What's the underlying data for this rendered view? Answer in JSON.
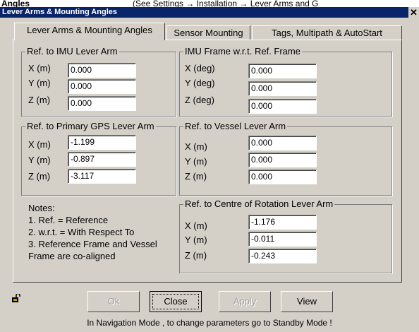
{
  "background": {
    "left_text": "Angles",
    "right_text": "(See Settings → Installation → Lever Arms and G"
  },
  "window": {
    "title": "Lever Arms & Mounting Angles",
    "close_glyph": "✕"
  },
  "tabs": [
    {
      "label": "Lever Arms & Mounting Angles",
      "active": true
    },
    {
      "label": "Sensor Mounting",
      "active": false
    },
    {
      "label": "Tags, Multipath & AutoStart",
      "active": false
    }
  ],
  "groups": {
    "imu_lever": {
      "title": "Ref. to IMU Lever Arm",
      "rows": [
        {
          "label": "X (m)",
          "value": "0.000"
        },
        {
          "label": "Y (m)",
          "value": "0.000"
        },
        {
          "label": "Z (m)",
          "value": "0.000"
        }
      ]
    },
    "imu_frame": {
      "title": "IMU Frame w.r.t. Ref. Frame",
      "rows": [
        {
          "label": "X (deg)",
          "value": "0.000"
        },
        {
          "label": "Y (deg)",
          "value": "0.000"
        },
        {
          "label": "Z (deg)",
          "value": "0.000"
        }
      ]
    },
    "gps_lever": {
      "title": "Ref. to Primary GPS Lever Arm",
      "rows": [
        {
          "label": "X (m)",
          "value": "-1.199"
        },
        {
          "label": "Y (m)",
          "value": "-0.897"
        },
        {
          "label": "Z (m)",
          "value": "-3.117"
        }
      ]
    },
    "vessel_lever": {
      "title": "Ref. to Vessel Lever Arm",
      "rows": [
        {
          "label": "X (m)",
          "value": "0.000"
        },
        {
          "label": "Y (m)",
          "value": "0.000"
        },
        {
          "label": "Z (m)",
          "value": "0.000"
        }
      ]
    },
    "rotation_lever": {
      "title": "Ref. to Centre of Rotation Lever Arm",
      "rows": [
        {
          "label": "X (m)",
          "value": "-1.176"
        },
        {
          "label": "Y (m)",
          "value": "-0.011"
        },
        {
          "label": "Z (m)",
          "value": "-0.243"
        }
      ]
    }
  },
  "notes": [
    "Notes:",
    "1. Ref. = Reference",
    "2. w.r.t. = With Respect To",
    "3. Reference Frame and Vessel",
    " Frame are co-aligned"
  ],
  "buttons": {
    "ok": "Ok",
    "close": "Close",
    "apply": "Apply",
    "view": "View"
  },
  "icons": {
    "lock": "lock-icon"
  },
  "status": "In Navigation Mode , to change parameters go to Standby Mode !"
}
